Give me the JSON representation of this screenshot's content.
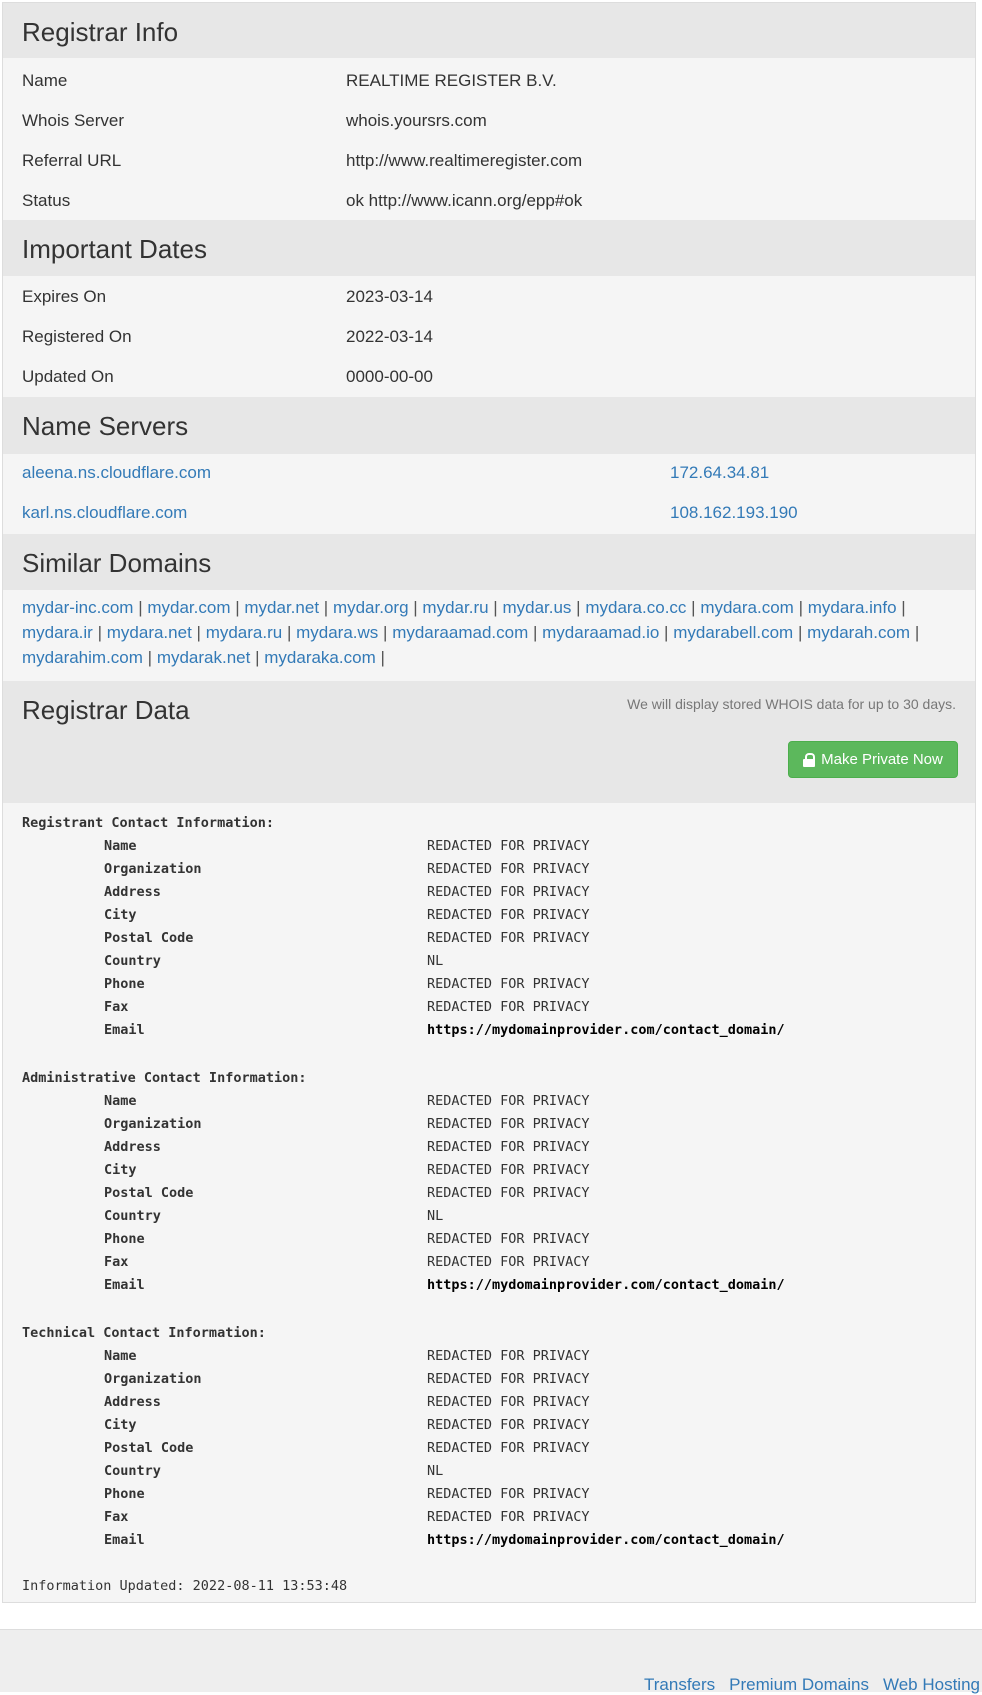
{
  "registrar_info": {
    "title": "Registrar Info",
    "rows": [
      {
        "label": "Name",
        "value": "REALTIME REGISTER B.V."
      },
      {
        "label": "Whois Server",
        "value": "whois.yoursrs.com"
      },
      {
        "label": "Referral URL",
        "value": "http://www.realtimeregister.com"
      },
      {
        "label": "Status",
        "value": "ok http://www.icann.org/epp#ok"
      }
    ]
  },
  "important_dates": {
    "title": "Important Dates",
    "rows": [
      {
        "label": "Expires On",
        "value": "2023-03-14"
      },
      {
        "label": "Registered On",
        "value": "2022-03-14"
      },
      {
        "label": "Updated On",
        "value": "0000-00-00"
      }
    ]
  },
  "name_servers": {
    "title": "Name Servers",
    "rows": [
      {
        "host": "aleena.ns.cloudflare.com",
        "ip": "172.64.34.81"
      },
      {
        "host": "karl.ns.cloudflare.com",
        "ip": "108.162.193.190"
      }
    ]
  },
  "similar_domains": {
    "title": "Similar Domains",
    "separator": "|",
    "domains": [
      "mydar-inc.com",
      "mydar.com",
      "mydar.net",
      "mydar.org",
      "mydar.ru",
      "mydar.us",
      "mydara.co.cc",
      "mydara.com",
      "mydara.info",
      "mydara.ir",
      "mydara.net",
      "mydara.ru",
      "mydara.ws",
      "mydaraamad.com",
      "mydaraamad.io",
      "mydarabell.com",
      "mydarah.com",
      "mydarahim.com",
      "mydarak.net",
      "mydaraka.com"
    ]
  },
  "registrar_data": {
    "title": "Registrar Data",
    "note": "We will display stored WHOIS data for up to 30 days.",
    "button_label": "Make Private Now",
    "button_icon": "lock-icon",
    "button_color": "#5cb85c",
    "contacts": [
      {
        "heading": "Registrant Contact Information:",
        "fields": [
          {
            "key": "Name",
            "value": "REDACTED FOR PRIVACY"
          },
          {
            "key": "Organization",
            "value": "REDACTED FOR PRIVACY"
          },
          {
            "key": "Address",
            "value": "REDACTED FOR PRIVACY"
          },
          {
            "key": "City",
            "value": "REDACTED FOR PRIVACY"
          },
          {
            "key": "Postal Code",
            "value": "REDACTED FOR PRIVACY"
          },
          {
            "key": "Country",
            "value": "NL"
          },
          {
            "key": "Phone",
            "value": "REDACTED FOR PRIVACY"
          },
          {
            "key": "Fax",
            "value": "REDACTED FOR PRIVACY"
          },
          {
            "key": "Email",
            "value": "https://mydomainprovider.com/contact_domain/"
          }
        ]
      },
      {
        "heading": "Administrative Contact Information:",
        "fields": [
          {
            "key": "Name",
            "value": "REDACTED FOR PRIVACY"
          },
          {
            "key": "Organization",
            "value": "REDACTED FOR PRIVACY"
          },
          {
            "key": "Address",
            "value": "REDACTED FOR PRIVACY"
          },
          {
            "key": "City",
            "value": "REDACTED FOR PRIVACY"
          },
          {
            "key": "Postal Code",
            "value": "REDACTED FOR PRIVACY"
          },
          {
            "key": "Country",
            "value": "NL"
          },
          {
            "key": "Phone",
            "value": "REDACTED FOR PRIVACY"
          },
          {
            "key": "Fax",
            "value": "REDACTED FOR PRIVACY"
          },
          {
            "key": "Email",
            "value": "https://mydomainprovider.com/contact_domain/"
          }
        ]
      },
      {
        "heading": "Technical Contact Information:",
        "fields": [
          {
            "key": "Name",
            "value": "REDACTED FOR PRIVACY"
          },
          {
            "key": "Organization",
            "value": "REDACTED FOR PRIVACY"
          },
          {
            "key": "Address",
            "value": "REDACTED FOR PRIVACY"
          },
          {
            "key": "City",
            "value": "REDACTED FOR PRIVACY"
          },
          {
            "key": "Postal Code",
            "value": "REDACTED FOR PRIVACY"
          },
          {
            "key": "Country",
            "value": "NL"
          },
          {
            "key": "Phone",
            "value": "REDACTED FOR PRIVACY"
          },
          {
            "key": "Fax",
            "value": "REDACTED FOR PRIVACY"
          },
          {
            "key": "Email",
            "value": "https://mydomainprovider.com/contact_domain/"
          }
        ]
      }
    ],
    "updated": "Information Updated: 2022-08-11 13:53:48"
  },
  "footer": {
    "links": [
      "Transfers",
      "Premium Domains",
      "Web Hosting"
    ]
  },
  "colors": {
    "link": "#337ab7",
    "section_header_bg": "#e7e7e7",
    "panel_bg": "#f5f5f5"
  }
}
